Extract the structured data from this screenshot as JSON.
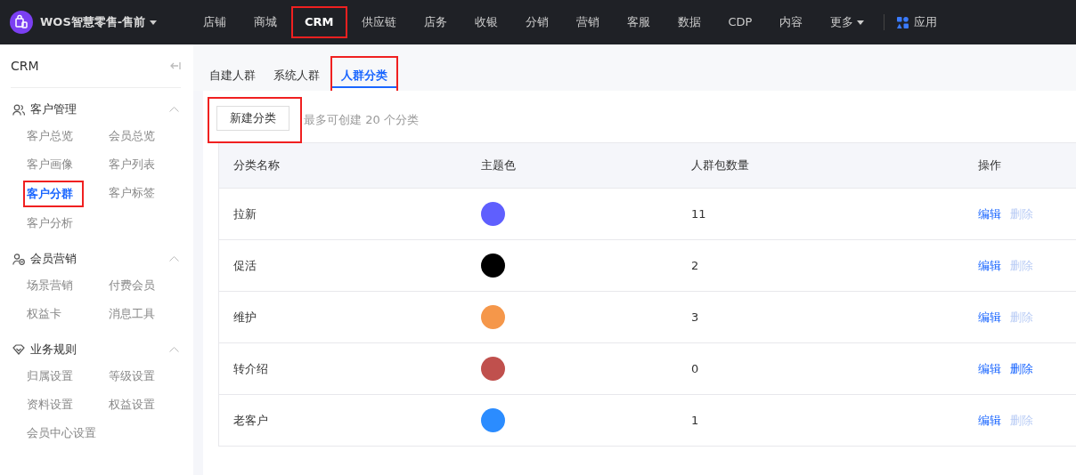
{
  "topbar": {
    "brand": "WOS智慧零售-售前",
    "nav": [
      {
        "label": "店铺",
        "selected": false,
        "highlighted": false,
        "dropdown": false
      },
      {
        "label": "商城",
        "selected": false,
        "highlighted": false,
        "dropdown": false
      },
      {
        "label": "CRM",
        "selected": true,
        "highlighted": true,
        "dropdown": false
      },
      {
        "label": "供应链",
        "selected": false,
        "highlighted": false,
        "dropdown": false
      },
      {
        "label": "店务",
        "selected": false,
        "highlighted": false,
        "dropdown": false
      },
      {
        "label": "收银",
        "selected": false,
        "highlighted": false,
        "dropdown": false
      },
      {
        "label": "分销",
        "selected": false,
        "highlighted": false,
        "dropdown": false
      },
      {
        "label": "营销",
        "selected": false,
        "highlighted": false,
        "dropdown": false
      },
      {
        "label": "客服",
        "selected": false,
        "highlighted": false,
        "dropdown": false
      },
      {
        "label": "数据",
        "selected": false,
        "highlighted": false,
        "dropdown": false
      },
      {
        "label": "CDP",
        "selected": false,
        "highlighted": false,
        "dropdown": false
      },
      {
        "label": "内容",
        "selected": false,
        "highlighted": false,
        "dropdown": false
      },
      {
        "label": "更多",
        "selected": false,
        "highlighted": false,
        "dropdown": true
      }
    ],
    "apps": "应用"
  },
  "sidebar": {
    "title": "CRM",
    "sections": [
      {
        "title": "客户管理",
        "expanded": true,
        "items": [
          {
            "label": "客户总览",
            "selected": false,
            "highlighted": false
          },
          {
            "label": "会员总览",
            "selected": false,
            "highlighted": false
          },
          {
            "label": "客户画像",
            "selected": false,
            "highlighted": false
          },
          {
            "label": "客户列表",
            "selected": false,
            "highlighted": false
          },
          {
            "label": "客户分群",
            "selected": true,
            "highlighted": true
          },
          {
            "label": "客户标签",
            "selected": false,
            "highlighted": false
          },
          {
            "label": "客户分析",
            "selected": false,
            "highlighted": false
          }
        ]
      },
      {
        "title": "会员营销",
        "expanded": true,
        "items": [
          {
            "label": "场景营销",
            "selected": false,
            "highlighted": false
          },
          {
            "label": "付费会员",
            "selected": false,
            "highlighted": false
          },
          {
            "label": "权益卡",
            "selected": false,
            "highlighted": false
          },
          {
            "label": "消息工具",
            "selected": false,
            "highlighted": false
          }
        ]
      },
      {
        "title": "业务规则",
        "expanded": true,
        "items": [
          {
            "label": "归属设置",
            "selected": false,
            "highlighted": false
          },
          {
            "label": "等级设置",
            "selected": false,
            "highlighted": false
          },
          {
            "label": "资料设置",
            "selected": false,
            "highlighted": false
          },
          {
            "label": "权益设置",
            "selected": false,
            "highlighted": false
          },
          {
            "label": "会员中心设置",
            "selected": false,
            "highlighted": false
          }
        ]
      }
    ]
  },
  "tabs": [
    {
      "label": "自建人群",
      "selected": false,
      "highlighted": false
    },
    {
      "label": "系统人群",
      "selected": false,
      "highlighted": false
    },
    {
      "label": "人群分类",
      "selected": true,
      "highlighted": true
    }
  ],
  "toolbar": {
    "button": {
      "label": "新建分类",
      "highlighted": true
    },
    "hint": "最多可创建 20 个分类"
  },
  "table": {
    "columns": [
      "分类名称",
      "主题色",
      "人群包数量",
      "操作"
    ],
    "rows": [
      {
        "name": "拉新",
        "color": "#5f5ffe",
        "count": "11",
        "actions": [
          {
            "label": "编辑",
            "disabled": false
          },
          {
            "label": "删除",
            "disabled": true
          }
        ]
      },
      {
        "name": "促活",
        "color": "#000000",
        "count": "2",
        "actions": [
          {
            "label": "编辑",
            "disabled": false
          },
          {
            "label": "删除",
            "disabled": true
          }
        ]
      },
      {
        "name": "维护",
        "color": "#f5974a",
        "count": "3",
        "actions": [
          {
            "label": "编辑",
            "disabled": false
          },
          {
            "label": "删除",
            "disabled": true
          }
        ]
      },
      {
        "name": "转介绍",
        "color": "#c0504d",
        "count": "0",
        "actions": [
          {
            "label": "编辑",
            "disabled": false
          },
          {
            "label": "删除",
            "disabled": false
          }
        ]
      },
      {
        "name": "老客户",
        "color": "#2b8cff",
        "count": "1",
        "actions": [
          {
            "label": "编辑",
            "disabled": false
          },
          {
            "label": "删除",
            "disabled": true
          }
        ]
      }
    ]
  }
}
